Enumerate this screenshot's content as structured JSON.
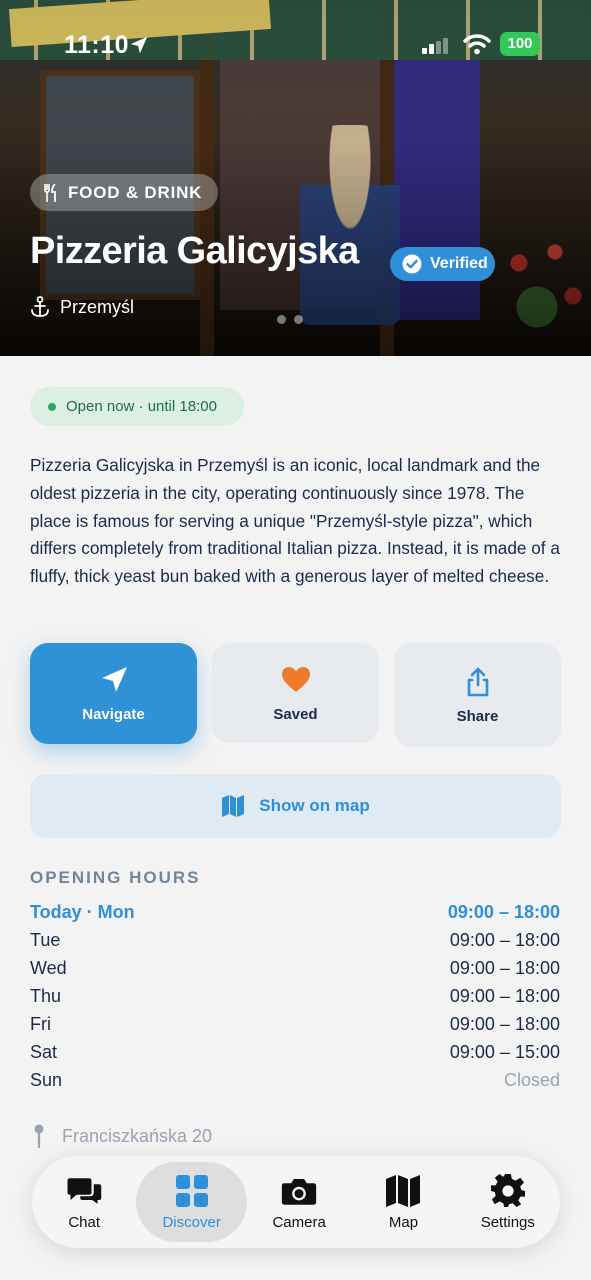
{
  "status_bar": {
    "time": "11:10",
    "battery": "100"
  },
  "hero": {
    "category": "FOOD & DRINK",
    "title": "Pizzeria Galicyjska",
    "verified_label": "Verified",
    "location": "Przemyśl"
  },
  "open_status": "Open now · until 18:00",
  "description": "Pizzeria Galicyjska in Przemyśl is an iconic, local landmark and the oldest pizzeria in the city, operating continuously since 1978. The place is famous for serving a unique \"Przemyśl-style pizza\", which differs completely from traditional Italian pizza. Instead, it is made of a fluffy, thick yeast bun baked with a generous layer of melted cheese.",
  "actions": {
    "navigate": "Navigate",
    "saved": "Saved",
    "share": "Share",
    "show_on_map": "Show on map"
  },
  "hours": {
    "heading": "OPENING HOURS",
    "rows": [
      {
        "day": "Today · Mon",
        "time": "09:00 – 18:00"
      },
      {
        "day": "Tue",
        "time": "09:00 – 18:00"
      },
      {
        "day": "Wed",
        "time": "09:00 – 18:00"
      },
      {
        "day": "Thu",
        "time": "09:00 – 18:00"
      },
      {
        "day": "Fri",
        "time": "09:00 – 18:00"
      },
      {
        "day": "Sat",
        "time": "09:00 – 15:00"
      },
      {
        "day": "Sun",
        "time": "Closed"
      }
    ]
  },
  "address": "Franciszkańska 20",
  "tabbar": {
    "chat": "Chat",
    "discover": "Discover",
    "camera": "Camera",
    "map": "Map",
    "settings": "Settings"
  },
  "colors": {
    "accent": "#2f8fd8",
    "open_green": "#2fa866",
    "saved_heart": "#ef7a2a"
  },
  "icons": [
    "location-arrow-icon",
    "signal-icon",
    "wifi-icon",
    "fork-knife-icon",
    "verified-badge-icon",
    "anchor-icon",
    "send-arrow-icon",
    "heart-icon",
    "share-icon",
    "map-icon",
    "pin-icon",
    "chat-icon",
    "grid-icon",
    "camera-icon",
    "gear-icon"
  ]
}
